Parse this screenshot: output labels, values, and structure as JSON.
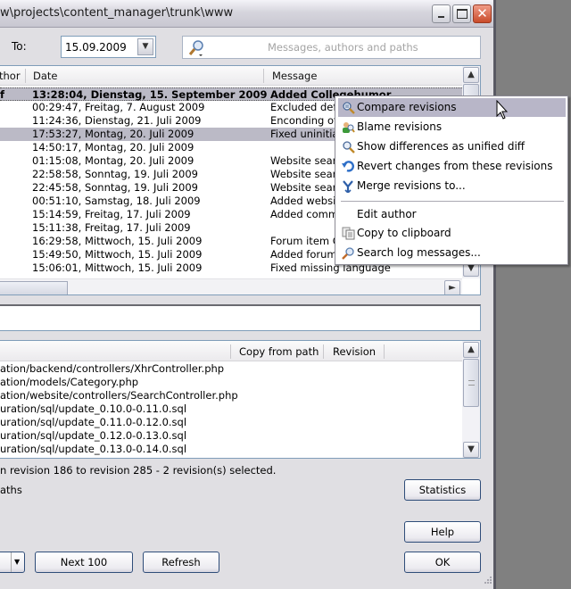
{
  "window": {
    "title": "w\\projects\\content_manager\\trunk\\www",
    "buttons": {
      "minimize": "minimize",
      "maximize": "maximize",
      "close": "close"
    }
  },
  "filter": {
    "to_label": "To:",
    "to_date": "15.09.2009",
    "search_placeholder": "Messages, authors and paths"
  },
  "log": {
    "columns": {
      "author": "thor",
      "date": "Date",
      "message": "Message"
    },
    "rows": [
      {
        "author": "f",
        "date": "13:28:04, Dienstag, 15. September 2009",
        "message": "Added Collegehumor"
      },
      {
        "author": "",
        "date": "00:29:47, Freitag, 7. August 2009",
        "message": "Excluded def"
      },
      {
        "author": "",
        "date": "11:24:36, Dienstag, 21. Juli 2009",
        "message": "Enconding of"
      },
      {
        "author": "",
        "date": "17:53:27, Montag, 20. Juli 2009",
        "message": "Fixed uninitial"
      },
      {
        "author": "",
        "date": "14:50:17, Montag, 20. Juli 2009",
        "message": ""
      },
      {
        "author": "",
        "date": "01:15:08, Montag, 20. Juli 2009",
        "message": "Website sear"
      },
      {
        "author": "",
        "date": "22:58:58, Sonntag, 19. Juli 2009",
        "message": "Website sear"
      },
      {
        "author": "",
        "date": "22:45:58, Sonntag, 19. Juli 2009",
        "message": "Website sear"
      },
      {
        "author": "",
        "date": "00:51:10, Samstag, 18. Juli 2009",
        "message": "Added websi"
      },
      {
        "author": "",
        "date": "15:14:59, Freitag, 17. Juli 2009",
        "message": "Added comm"
      },
      {
        "author": "",
        "date": "15:11:38, Freitag, 17. Juli 2009",
        "message": ""
      },
      {
        "author": "",
        "date": "16:29:58, Mittwoch, 15. Juli 2009",
        "message": "Forum item C"
      },
      {
        "author": "",
        "date": "15:49:50, Mittwoch, 15. Juli 2009",
        "message": "Added forum"
      },
      {
        "author": "",
        "date": "15:06:01, Mittwoch, 15. Juli 2009",
        "message": "Fixed missing language"
      }
    ]
  },
  "paths": {
    "columns": {
      "copy_from_path": "Copy from path",
      "revision": "Revision"
    },
    "rows": [
      "ation/backend/controllers/XhrController.php",
      "ation/models/Category.php",
      "ation/website/controllers/SearchController.php",
      "uration/sql/update_0.10.0-0.11.0.sql",
      "uration/sql/update_0.11.0-0.12.0.sql",
      "uration/sql/update_0.12.0-0.13.0.sql",
      "uration/sql/update_0.13.0-0.14.0.sql"
    ]
  },
  "status": {
    "text": "n revision 186 to revision 285 - 2 revision(s) selected.",
    "paths_label": "aths"
  },
  "buttons": {
    "statistics": "Statistics",
    "help": "Help",
    "next100": "Next 100",
    "refresh": "Refresh",
    "ok": "OK"
  },
  "context_menu": {
    "items": [
      {
        "label": "Compare revisions",
        "icon": "compare-icon",
        "highlighted": true
      },
      {
        "label": "Blame revisions",
        "icon": "blame-icon"
      },
      {
        "label": "Show differences as unified diff",
        "icon": "diff-icon"
      },
      {
        "label": "Revert changes from these revisions",
        "icon": "revert-icon"
      },
      {
        "label": "Merge revisions to...",
        "icon": "merge-icon"
      },
      {
        "label": "Edit author",
        "icon": ""
      },
      {
        "label": "Copy to clipboard",
        "icon": "copy-icon"
      },
      {
        "label": "Search log messages...",
        "icon": "search-icon"
      }
    ]
  }
}
